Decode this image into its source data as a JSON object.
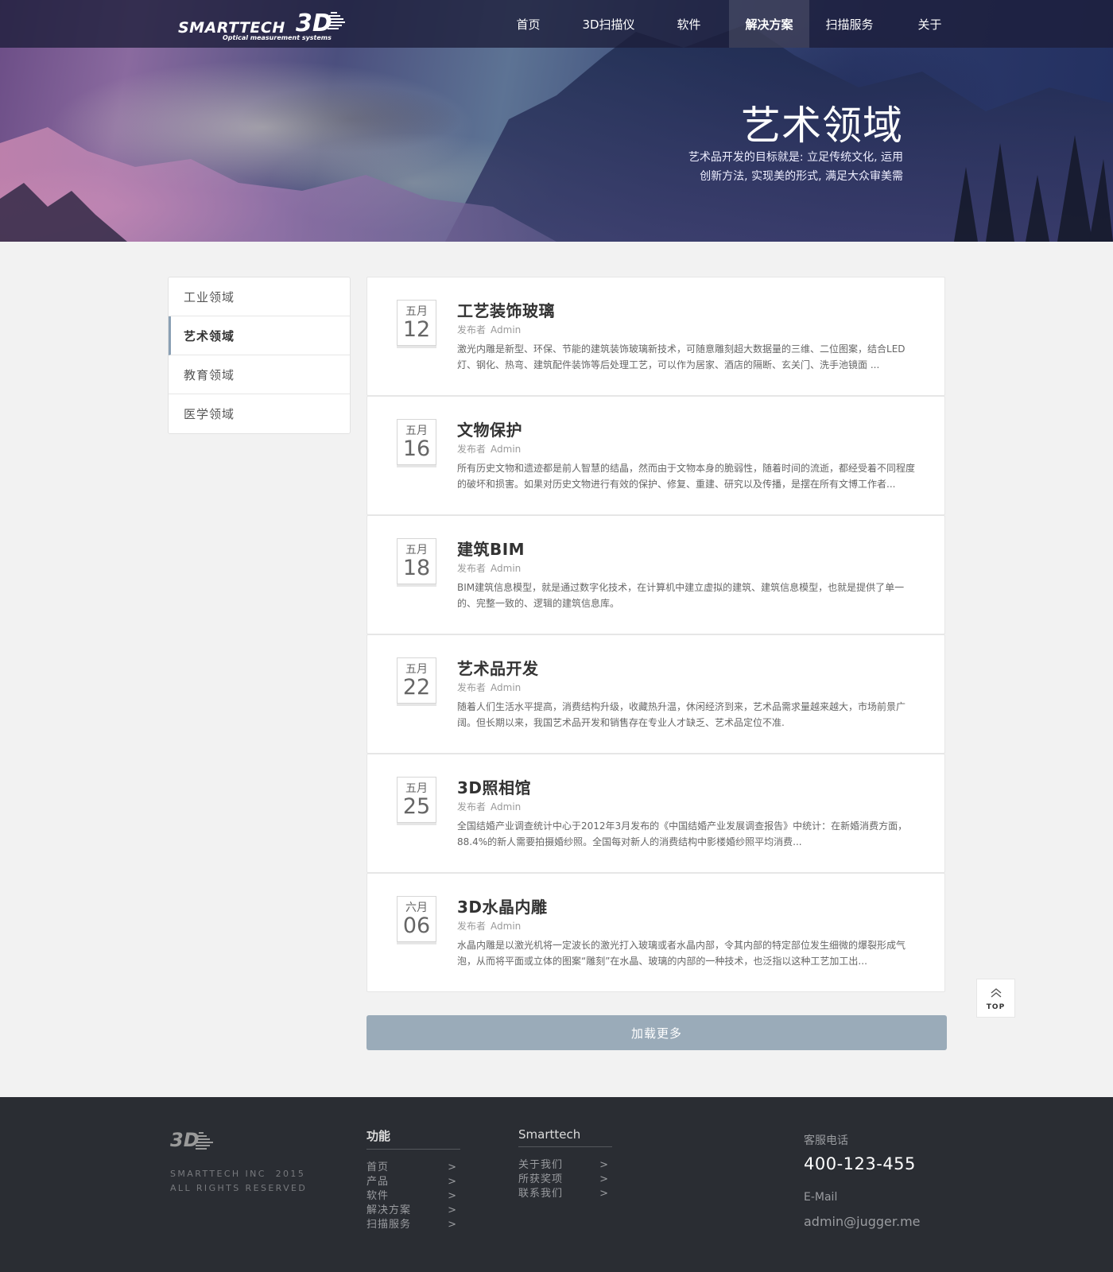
{
  "header": {
    "logo_text": "SMARTTECH",
    "logo_3d": "3D",
    "logo_sub": "Optical measurement systems",
    "nav": [
      {
        "label": "首页"
      },
      {
        "label": "3D扫描仪"
      },
      {
        "label": "软件"
      },
      {
        "label": "解决方案",
        "active": true
      },
      {
        "label": "扫描服务"
      },
      {
        "label": "关于"
      }
    ]
  },
  "hero": {
    "title": "艺术领域",
    "desc_line1": "艺术品开发的目标就是: 立足传统文化, 运用",
    "desc_line2": "创新方法, 实现美的形式, 满足大众审美需"
  },
  "sidebar": {
    "items": [
      {
        "label": "工业领域"
      },
      {
        "label": "艺术领域",
        "active": true
      },
      {
        "label": "教育领域"
      },
      {
        "label": "医学领域"
      }
    ]
  },
  "articles": [
    {
      "month": "五月",
      "day": "12",
      "title": "工艺装饰玻璃",
      "author_label": "发布者",
      "author": "Admin",
      "body": "激光内雕是新型、环保、节能的建筑装饰玻璃新技术，可随意雕刻超大数据量的三维、二位图案，结合LED灯、钢化、热弯、建筑配件装饰等后处理工艺，可以作为居家、酒店的隔断、玄关门、洗手池镜面 ..."
    },
    {
      "month": "五月",
      "day": "16",
      "title": "文物保护",
      "author_label": "发布者",
      "author": "Admin",
      "body": "所有历史文物和遗迹都是前人智慧的结晶，然而由于文物本身的脆弱性，随着时间的流逝，都经受着不同程度的破坏和损害。如果对历史文物进行有效的保护、修复、重建、研究以及传播，是摆在所有文博工作者..."
    },
    {
      "month": "五月",
      "day": "18",
      "title": "建筑BIM",
      "author_label": "发布者",
      "author": "Admin",
      "body": "BIM建筑信息模型，就是通过数字化技术，在计算机中建立虚拟的建筑、建筑信息模型，也就是提供了单一的、完整一致的、逻辑的建筑信息库。"
    },
    {
      "month": "五月",
      "day": "22",
      "title": "艺术品开发",
      "author_label": "发布者",
      "author": "Admin",
      "body": "随着人们生活水平提高，消费结构升级，收藏热升温，休闲经济到来，艺术品需求量越来越大，市场前景广阔。但长期以来，我国艺术品开发和销售存在专业人才缺乏、艺术品定位不准."
    },
    {
      "month": "五月",
      "day": "25",
      "title": "3D照相馆",
      "author_label": "发布者",
      "author": "Admin",
      "body": "全国结婚产业调查统计中心于2012年3月发布的《中国结婚产业发展调查报告》中统计：在新婚消费方面，88.4%的新人需要拍摄婚纱照。全国每对新人的消费结构中影楼婚纱照平均消费..."
    },
    {
      "month": "六月",
      "day": "06",
      "title": "3D水晶内雕",
      "author_label": "发布者",
      "author": "Admin",
      "body": "水晶内雕是以激光机将一定波长的激光打入玻璃或者水晶内部，令其内部的特定部位发生细微的爆裂形成气泡，从而将平面或立体的图案“雕刻”在水晶、玻璃的内部的一种技术，也泛指以这种工艺加工出..."
    }
  ],
  "load_more": "加载更多",
  "top_button": "TOP",
  "footer": {
    "logo_3d": "3D",
    "copyright_line1": "SMARTTECH INC  2015",
    "copyright_line2": "ALL RIGHTS RESERVED",
    "col1": {
      "title": "功能",
      "links": [
        "首页",
        "产品",
        "软件",
        "解决方案",
        "扫描服务"
      ],
      "arrow": ">"
    },
    "col2": {
      "title": "Smarttech",
      "links": [
        "关于我们",
        "所获奖项",
        "联系我们"
      ],
      "arrow": ">"
    },
    "phone_label": "客服电话",
    "phone": "400-123-455",
    "email_label": "E-Mail",
    "email": "admin@jugger.me"
  },
  "colors": {
    "nav_bg": "#1c1e3a",
    "accent": "#8aa0b4",
    "load_more_bg": "#9aabb9",
    "footer_bg": "#2a2d33"
  }
}
